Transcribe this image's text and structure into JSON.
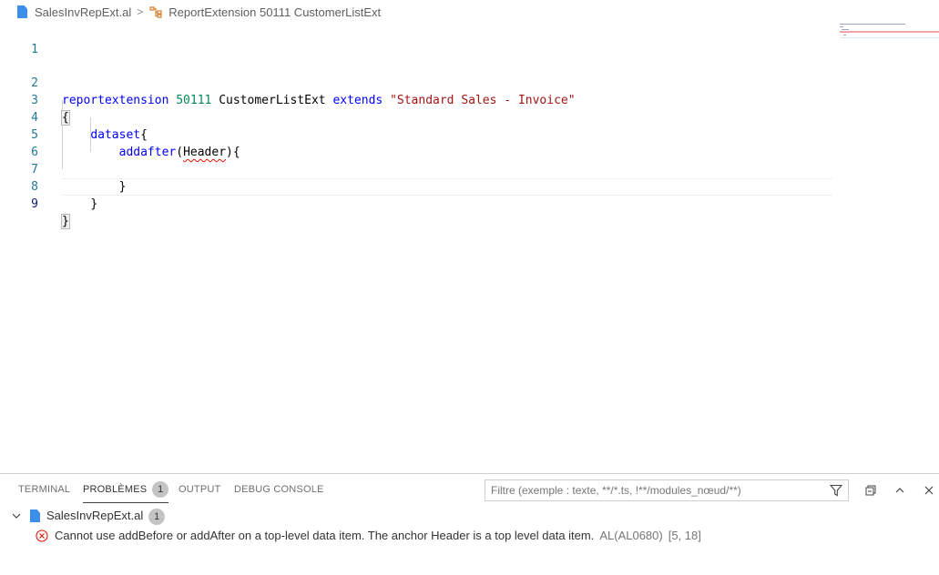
{
  "breadcrumb": {
    "file": "SalesInvRepExt.al",
    "separator": ">",
    "symbol": "ReportExtension 50111 CustomerListExt"
  },
  "editor": {
    "lines": [
      {
        "n": "1",
        "text": ""
      },
      {
        "n": "2",
        "text": "reportextension 50111 CustomerListExt extends \"Standard Sales - Invoice\""
      },
      {
        "n": "3",
        "text": "{"
      },
      {
        "n": "4",
        "text": "    dataset{"
      },
      {
        "n": "5",
        "text": "        addafter(Header){"
      },
      {
        "n": "6",
        "text": ""
      },
      {
        "n": "7",
        "text": "        }"
      },
      {
        "n": "8",
        "text": "    }"
      },
      {
        "n": "9",
        "text": "}"
      }
    ],
    "tokens": {
      "kw_reportextension": "reportextension",
      "num_id": "50111",
      "name": "CustomerListExt",
      "kw_extends": "extends",
      "str_base": "\"Standard Sales - Invoice\"",
      "open_brace": "{",
      "dataset": "dataset",
      "dataset_brace": "{",
      "addafter": "addafter",
      "paren_open": "(",
      "header": "Header",
      "paren_close_brace": "){",
      "close_brace_inner": "}",
      "close_brace_mid": "}",
      "close_brace_outer": "}"
    },
    "active_line": "9"
  },
  "panel": {
    "tabs": [
      {
        "label": "TERMINAL"
      },
      {
        "label": "PROBLÈMES",
        "badge": "1"
      },
      {
        "label": "OUTPUT"
      },
      {
        "label": "DEBUG CONSOLE"
      }
    ],
    "filter_placeholder": "Filtre (exemple : texte, **/*.ts, !**/modules_nœud/**)",
    "problems": {
      "file": "SalesInvRepExt.al",
      "file_count": "1",
      "message": "Cannot use addBefore or addAfter on a top-level data item. The anchor Header is a top level data item.",
      "code": "AL(AL0680)",
      "location": "[5, 18]"
    }
  },
  "colors": {
    "keyword": "#0000ff",
    "number": "#098658",
    "string": "#a31515",
    "line_number": "#237893",
    "error": "#e51400"
  }
}
